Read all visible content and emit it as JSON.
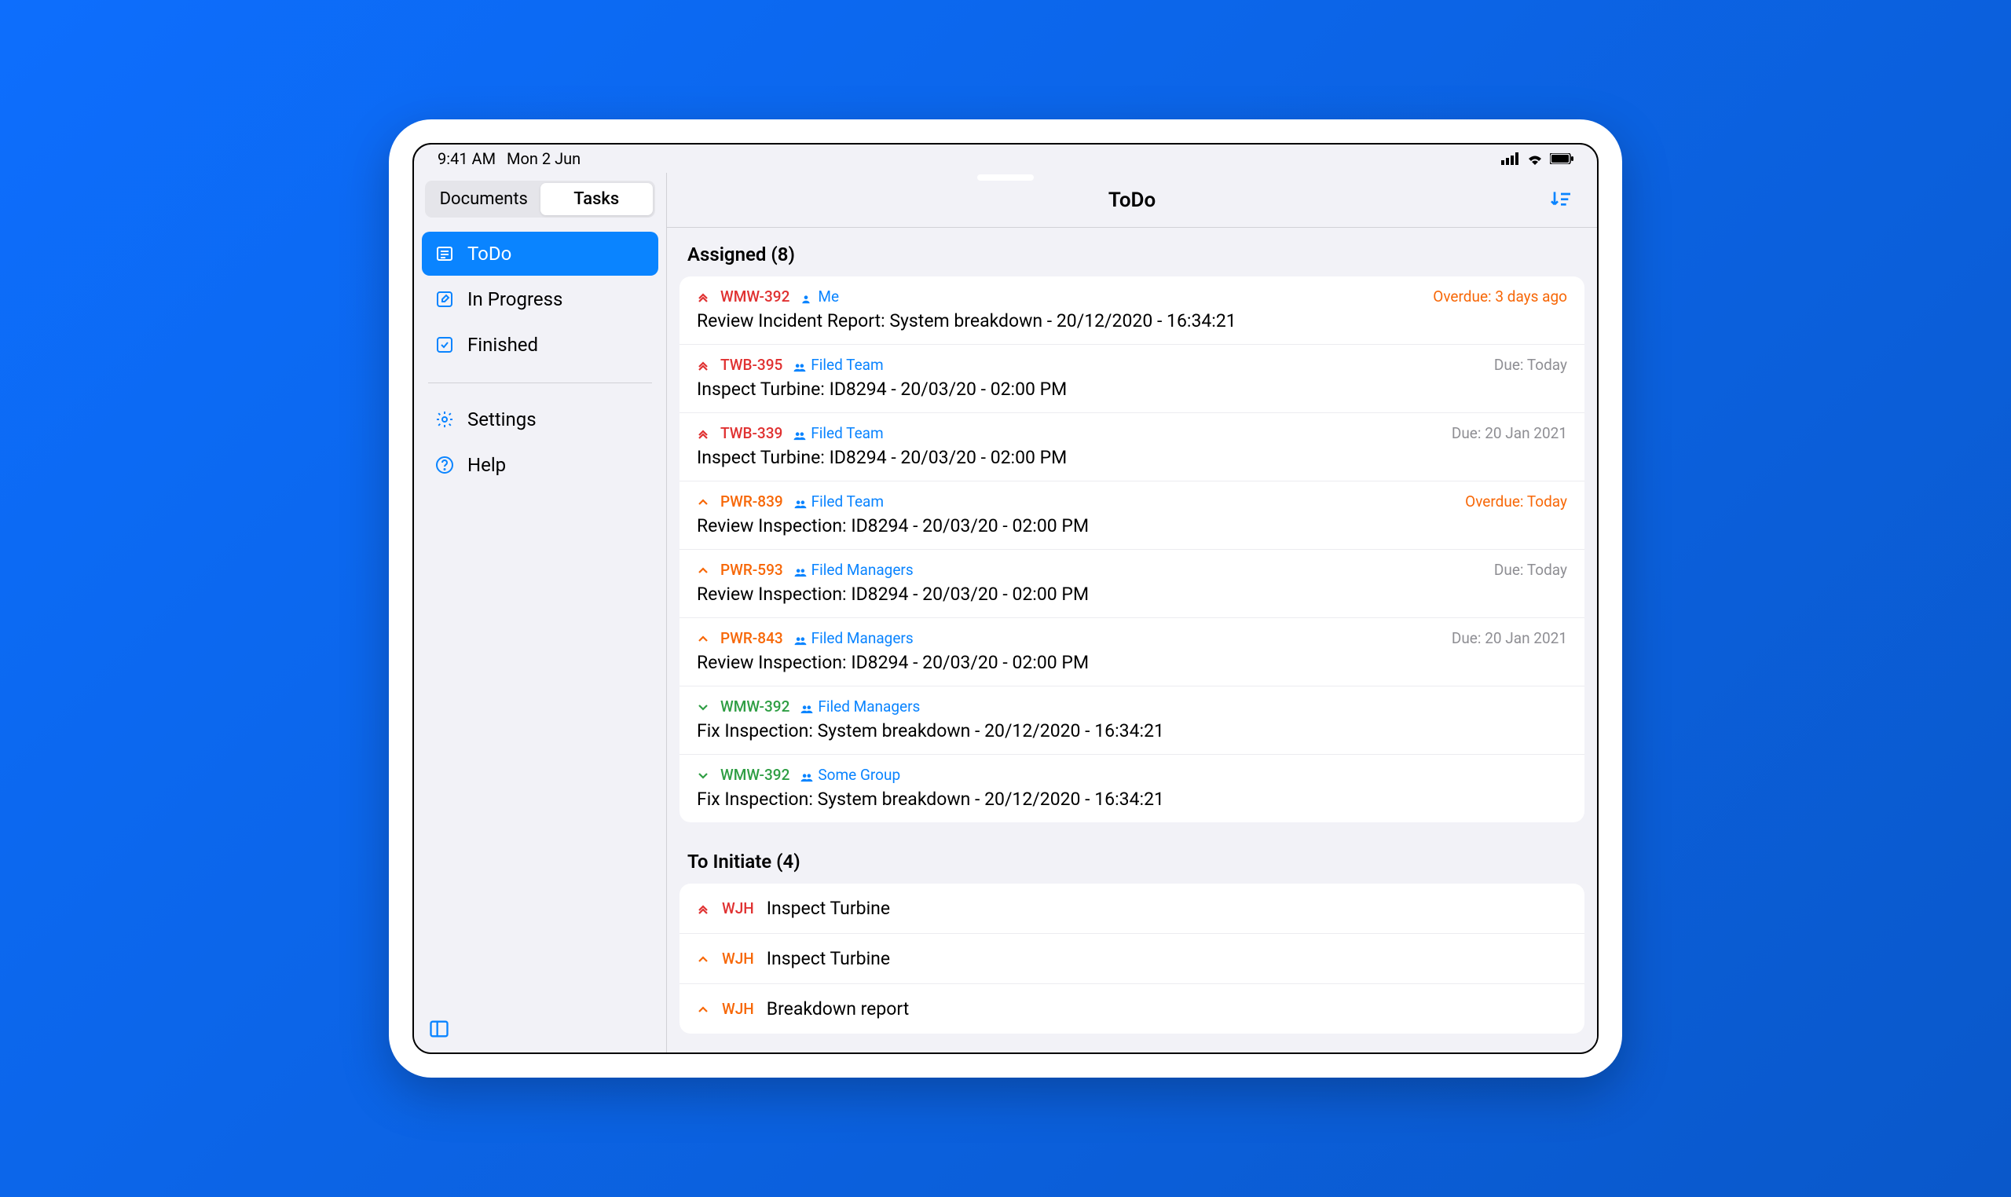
{
  "status": {
    "time": "9:41 AM",
    "date": "Mon 2 Jun"
  },
  "tabs": {
    "documents": "Documents",
    "tasks": "Tasks",
    "active": "tasks"
  },
  "sidebar": {
    "items": [
      {
        "label": "ToDo",
        "icon": "list",
        "active": true
      },
      {
        "label": "In Progress",
        "icon": "edit",
        "active": false
      },
      {
        "label": "Finished",
        "icon": "check",
        "active": false
      }
    ],
    "secondary": [
      {
        "label": "Settings",
        "icon": "gear"
      },
      {
        "label": "Help",
        "icon": "help"
      }
    ]
  },
  "main": {
    "title": "ToDo",
    "sections": [
      {
        "header": "Assigned (8)",
        "tasks": [
          {
            "priority": "highest",
            "id": "WMW-392",
            "id_color": "red",
            "assignee": "Me",
            "assignee_icon": "person",
            "due": "Overdue: 3 days ago",
            "due_type": "overdue",
            "title": "Review Incident Report: System breakdown - 20/12/2020 - 16:34:21"
          },
          {
            "priority": "highest",
            "id": "TWB-395",
            "id_color": "red",
            "assignee": "Filed Team",
            "assignee_icon": "group",
            "due": "Due: Today",
            "due_type": "normal",
            "title": "Inspect Turbine: ID8294 - 20/03/20 - 02:00 PM"
          },
          {
            "priority": "highest",
            "id": "TWB-339",
            "id_color": "red",
            "assignee": "Filed Team",
            "assignee_icon": "group",
            "due": "Due: 20 Jan 2021",
            "due_type": "normal",
            "title": "Inspect Turbine: ID8294 - 20/03/20 - 02:00 PM"
          },
          {
            "priority": "high",
            "id": "PWR-839",
            "id_color": "orange",
            "assignee": "Filed Team",
            "assignee_icon": "group",
            "due": "Overdue: Today",
            "due_type": "overdue",
            "title": "Review Inspection: ID8294 - 20/03/20 - 02:00 PM"
          },
          {
            "priority": "high",
            "id": "PWR-593",
            "id_color": "orange",
            "assignee": "Filed Managers",
            "assignee_icon": "group",
            "due": "Due: Today",
            "due_type": "normal",
            "title": "Review Inspection: ID8294 - 20/03/20 - 02:00 PM"
          },
          {
            "priority": "high",
            "id": "PWR-843",
            "id_color": "orange",
            "assignee": "Filed Managers",
            "assignee_icon": "group",
            "due": "Due: 20 Jan 2021",
            "due_type": "normal",
            "title": "Review Inspection: ID8294 - 20/03/20 - 02:00 PM"
          },
          {
            "priority": "low",
            "id": "WMW-392",
            "id_color": "green",
            "assignee": "Filed Managers",
            "assignee_icon": "group",
            "due": "",
            "due_type": "normal",
            "title": "Fix Inspection: System breakdown - 20/12/2020 - 16:34:21"
          },
          {
            "priority": "low",
            "id": "WMW-392",
            "id_color": "green",
            "assignee": "Some Group",
            "assignee_icon": "group",
            "due": "",
            "due_type": "normal",
            "title": "Fix Inspection: System breakdown - 20/12/2020 - 16:34:21"
          }
        ]
      },
      {
        "header": "To Initiate (4)",
        "initiate": [
          {
            "priority": "highest",
            "id": "WJH",
            "id_color": "red",
            "title": "Inspect Turbine"
          },
          {
            "priority": "high",
            "id": "WJH",
            "id_color": "orange",
            "title": "Inspect Turbine"
          },
          {
            "priority": "high",
            "id": "WJH",
            "id_color": "orange",
            "title": "Breakdown report"
          }
        ]
      }
    ]
  }
}
